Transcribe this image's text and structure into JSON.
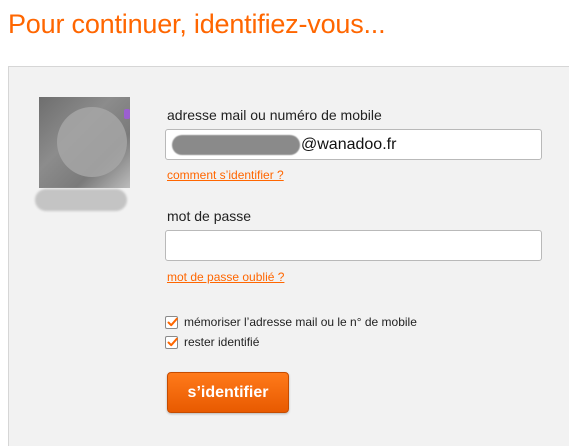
{
  "page": {
    "title": "Pour continuer, identifiez-vous..."
  },
  "login": {
    "email_label": "adresse mail ou numéro de mobile",
    "email_value_visible_suffix": "@wanadoo.fr",
    "email_help_link": "comment s’identifier ?",
    "password_label": "mot de passe",
    "password_value": "",
    "forgot_password_link": "mot de passe oublié ?",
    "remember_label": "mémoriser l’adresse mail ou le n° de mobile",
    "remember_checked": true,
    "stay_logged_label": "rester identifié",
    "stay_logged_checked": true,
    "submit_label": "s’identifier"
  },
  "colors": {
    "accent": "#ff6600",
    "panel_bg": "#f2f2f2"
  }
}
